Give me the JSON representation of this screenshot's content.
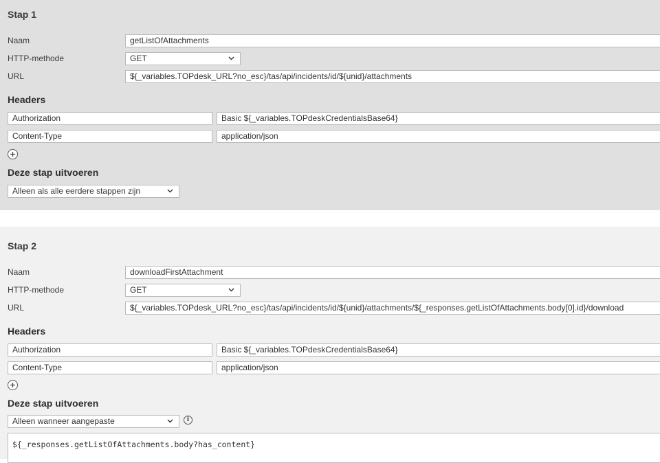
{
  "steps": [
    {
      "title": "Stap 1",
      "name_label": "Naam",
      "name_value": "getListOfAttachments",
      "method_label": "HTTP-methode",
      "method_value": "GET",
      "url_label": "URL",
      "url_value": "${_variables.TOPdesk_URL?no_esc}/tas/api/incidents/id/${unid}/attachments",
      "headers_title": "Headers",
      "headers": [
        {
          "key": "Authorization",
          "value": "Basic ${_variables.TOPdeskCredentialsBase64}"
        },
        {
          "key": "Content-Type",
          "value": "application/json"
        }
      ],
      "execute_title": "Deze stap uitvoeren",
      "execute_value": "Alleen als alle eerdere stappen zijn"
    },
    {
      "title": "Stap 2",
      "name_label": "Naam",
      "name_value": "downloadFirstAttachment",
      "method_label": "HTTP-methode",
      "method_value": "GET",
      "url_label": "URL",
      "url_value": "${_variables.TOPdesk_URL?no_esc}/tas/api/incidents/id/${unid}/attachments/${_responses.getListOfAttachments.body[0].id}/download",
      "headers_title": "Headers",
      "headers": [
        {
          "key": "Authorization",
          "value": "Basic ${_variables.TOPdeskCredentialsBase64}"
        },
        {
          "key": "Content-Type",
          "value": "application/json"
        }
      ],
      "execute_title": "Deze stap uitvoeren",
      "execute_value": "Alleen wanneer aangepaste",
      "condition_value": "${_responses.getListOfAttachments.body?has_content}"
    }
  ],
  "icons": {
    "add": "plus-circle-icon",
    "dropdown": "chevron-down-icon",
    "info": "info-icon"
  },
  "colors": {
    "step1_bg": "#e0e0e0",
    "step2_bg": "#f1f1f1",
    "field_border": "#b9b9b9"
  }
}
